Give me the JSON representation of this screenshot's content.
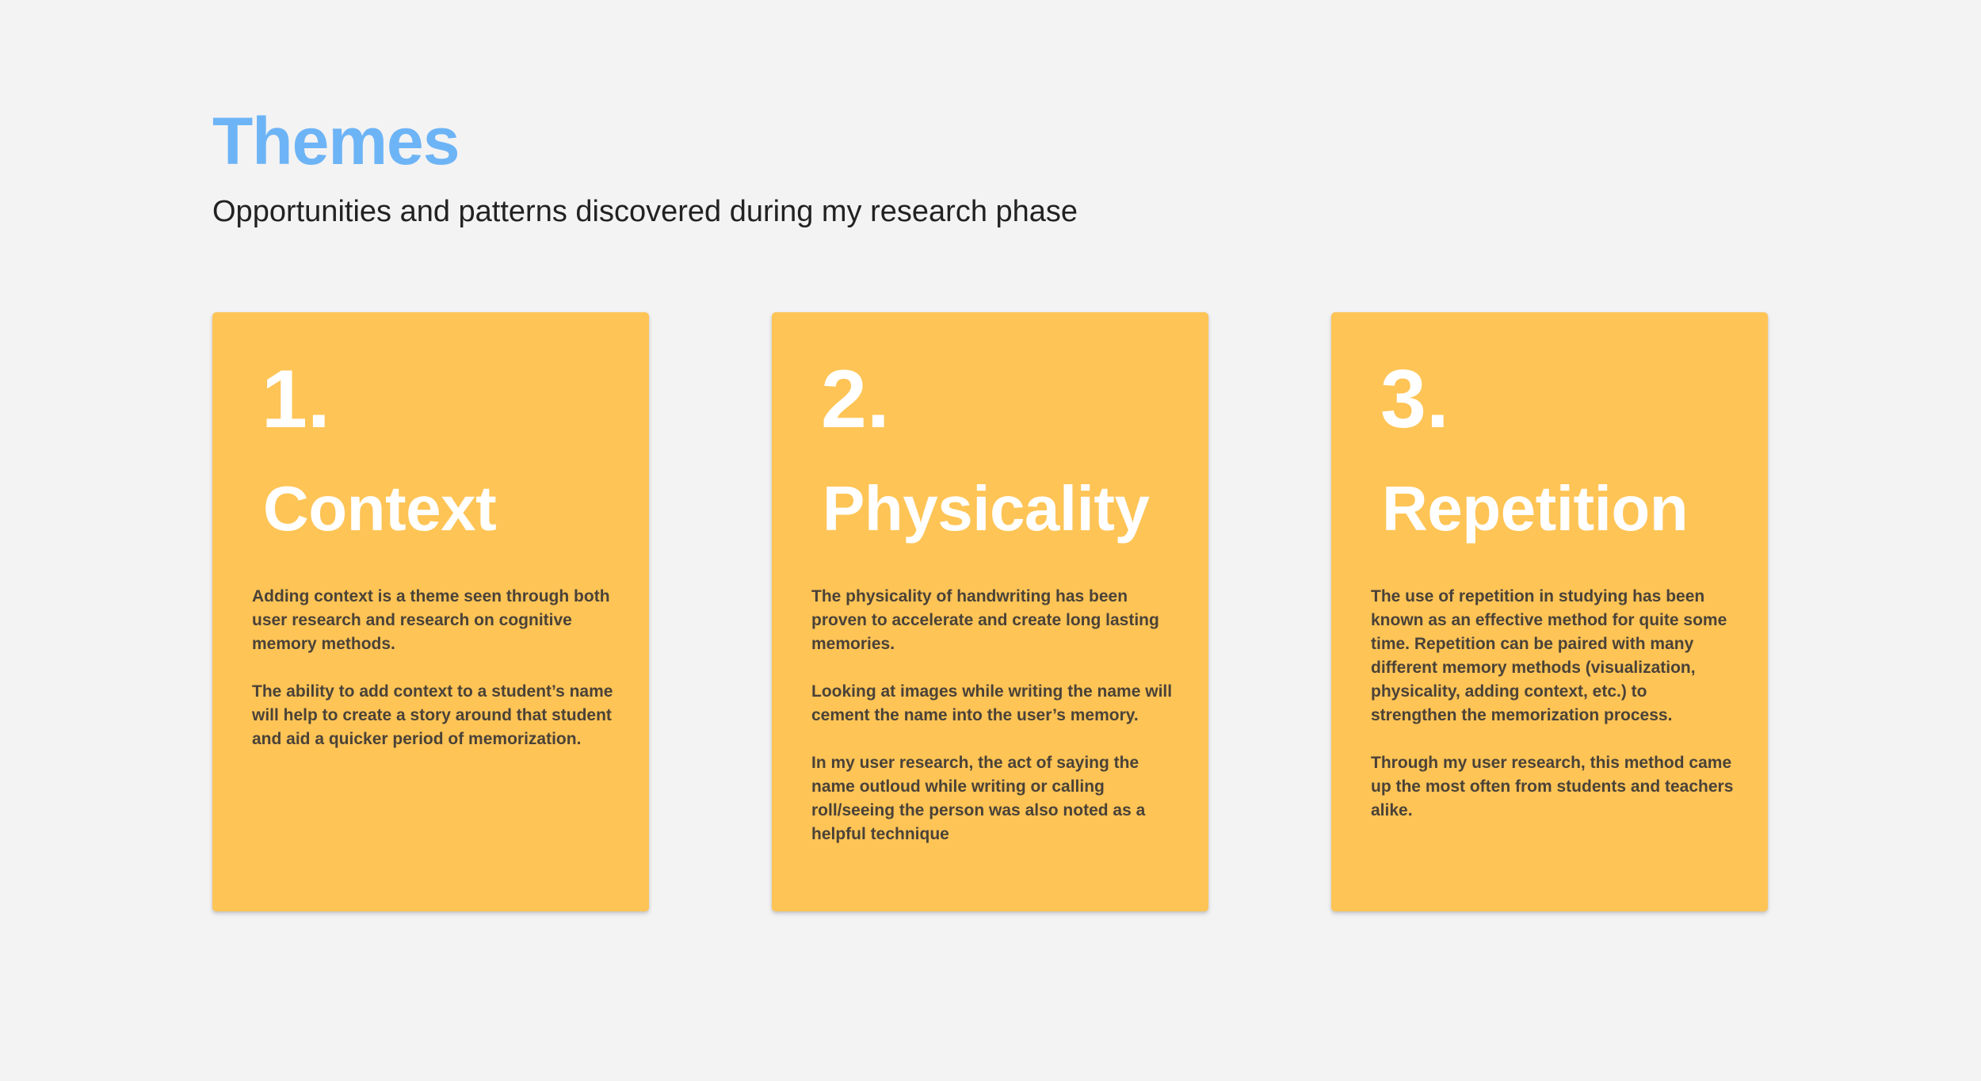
{
  "header": {
    "title": "Themes",
    "subtitle": "Opportunities and patterns discovered during my research phase"
  },
  "cards": [
    {
      "number": "1.",
      "heading": "Context",
      "paragraphs": [
        "Adding context is a theme seen through both user research and research on cognitive memory methods.",
        "The ability to add context to a student’s name will help to create a story around that student and aid a quicker period of memorization."
      ]
    },
    {
      "number": "2.",
      "heading": "Physicality",
      "paragraphs": [
        "The physicality of handwriting has been proven to accelerate and create long lasting memories.",
        "Looking at images while writing the name will cement the name into the user’s memory.",
        "In my user research, the act of saying the name outloud while writing or calling roll/seeing the person was also noted as a helpful technique"
      ]
    },
    {
      "number": "3.",
      "heading": "Repetition",
      "paragraphs": [
        "The use of repetition in studying has been known as an effective method for quite some time. Repetition can be paired with many different memory methods (visualization, physicality, adding context, etc.) to strengthen the memorization process.",
        "Through my user research, this method came up the most often from students and teachers alike."
      ]
    }
  ],
  "colors": {
    "background": "#f3f3f3",
    "title_accent": "#6db4f6",
    "card_background": "#fec456",
    "card_heading_text": "#ffffff",
    "card_body_text": "#4a4238"
  }
}
